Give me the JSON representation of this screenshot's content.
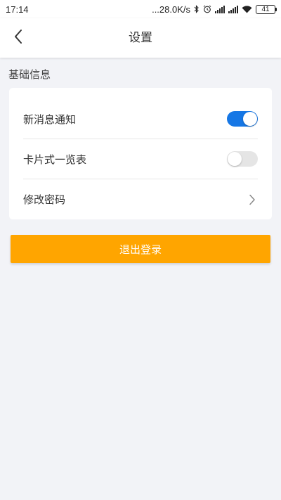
{
  "status_bar": {
    "time": "17:14",
    "network_speed": "...28.0K/s",
    "battery": "41",
    "icons": [
      "bluetooth-icon",
      "alarm-icon",
      "signal-icon",
      "signal-icon",
      "wifi-icon",
      "battery-icon"
    ]
  },
  "nav": {
    "title": "设置",
    "back_icon": "chevron-left-icon"
  },
  "section": {
    "title": "基础信息"
  },
  "settings": {
    "items": [
      {
        "label": "新消息通知",
        "type": "toggle",
        "on": true
      },
      {
        "label": "卡片式一览表",
        "type": "toggle",
        "on": false
      },
      {
        "label": "修改密码",
        "type": "link",
        "icon": "chevron-right-icon"
      }
    ]
  },
  "logout": {
    "label": "退出登录"
  },
  "colors": {
    "accent": "#1677e5",
    "button": "#ffa500",
    "background": "#f2f3f7"
  }
}
